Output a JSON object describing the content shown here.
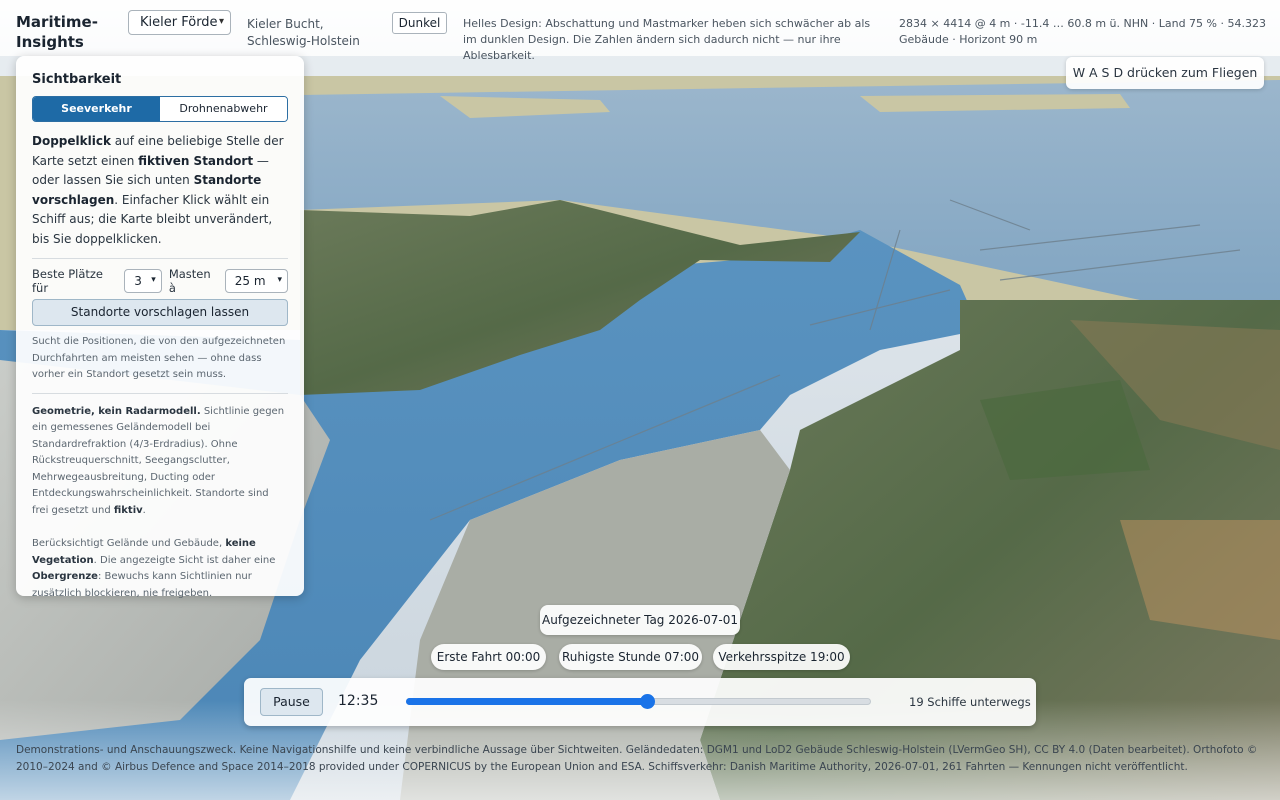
{
  "header": {
    "brand": "Maritime-Insights",
    "region_select": "Kieler Förde",
    "region_desc": "Kieler Bucht, Schleswig-Holstein",
    "theme_button": "Dunkel",
    "theme_note": "Helles Design: Abschattung und Mastmarker heben sich schwächer ab als im dunklen Design. Die Zahlen ändern sich dadurch nicht — nur ihre Ablesbarkeit.",
    "model_stats": "2834 × 4414 @ 4 m · -11.4 … 60.8 m ü. NHN · Land 75 % · 54.323 Gebäude · Horizont 90 m"
  },
  "wasd_hint": "W A S D drücken zum Fliegen",
  "panel": {
    "title": "Sichtbarkeit",
    "tabs": {
      "active": "Seeverkehr",
      "inactive": "Drohnenabwehr"
    },
    "intro": {
      "t1": "Doppelklick",
      "t2": " auf eine beliebige Stelle der Karte setzt einen ",
      "t3": "fiktiven Standort",
      "t4": " — oder lassen Sie sich unten ",
      "t5": "Standorte vorschlagen",
      "t6": ". Einfacher Klick wählt ein Schiff aus; die Karte bleibt unverändert, bis Sie doppelklicken."
    },
    "best_label": "Beste Plätze für",
    "best_value": "3",
    "mast_label": "Masten à",
    "mast_value": "25 m",
    "suggest_button": "Standorte vorschlagen lassen",
    "suggest_help": "Sucht die Positionen, die von den aufgezeichneten Durchfahrten am meisten sehen — ohne dass vorher ein Standort gesetzt sein muss.",
    "geo": {
      "bold": "Geometrie, kein Radarmodell.",
      "b1": " Sichtlinie gegen ein gemessenes Geländemodell bei Standardrefraktion (4/3-Erdradius). Ohne Rückstreuquerschnitt, Seegangsclutter, Mehrwegeausbreitung, Ducting oder Entdeckungswahrscheinlichkeit. Standorte sind frei gesetzt und ",
      "fiktiv": "fiktiv",
      "dot": "."
    },
    "veg": {
      "a": "Berücksichtigt Gelände und Gebäude, ",
      "b": "keine Vegetation",
      "c": ". Die angezeigte Sicht ist daher eine ",
      "d": "Obergrenze",
      "e": ": Bewuchs kann Sichtlinien nur zusätzlich blockieren, nie freigeben."
    }
  },
  "day": {
    "label": "Aufgezeichneter Tag 2026-07-01",
    "chips": [
      "Erste Fahrt 00:00",
      "Ruhigste Stunde 07:00",
      "Verkehrsspitze 19:00"
    ]
  },
  "player": {
    "pause": "Pause",
    "time": "12:35",
    "progress": 0.52,
    "ships": "19 Schiffe unterwegs"
  },
  "footer": "Demonstrations- und Anschauungszweck. Keine Navigationshilfe und keine verbindliche Aussage über Sichtweiten. Geländedaten: DGM1 und LoD2 Gebäude Schleswig-Holstein (LVermGeo SH), CC BY 4.0 (Daten bearbeitet). Orthofoto © 2010–2024 and © Airbus Defence and Space 2014–2018 provided under COPERNICUS by the European Union and ESA. Schiffsverkehr: Danish Maritime Authority, 2026-07-01, 261 Fahrten — Kennungen nicht veröffentlicht.",
  "colors": {
    "accent": "#1a73e8",
    "tab_active": "#1e6aa6",
    "water": "#4f8fbf",
    "sky": "#dfe7ee",
    "sand": "#c9c6a4"
  }
}
